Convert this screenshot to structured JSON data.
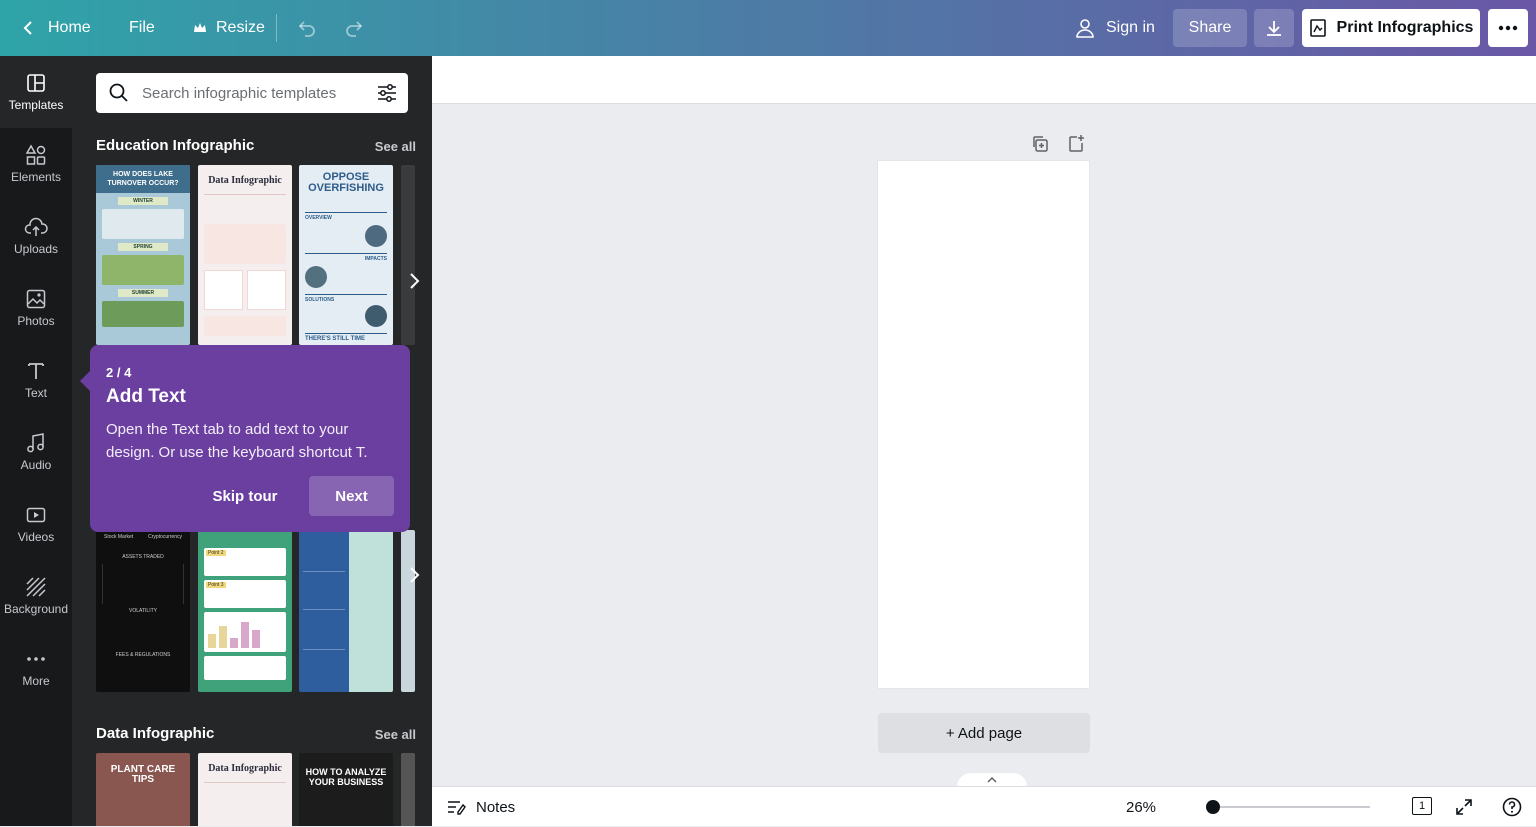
{
  "topbar": {
    "home": "Home",
    "file": "File",
    "resize": "Resize",
    "sign_in": "Sign in",
    "share": "Share",
    "print": "Print Infographics"
  },
  "rail": {
    "items": [
      {
        "label": "Templates",
        "icon": "templates-icon"
      },
      {
        "label": "Elements",
        "icon": "elements-icon"
      },
      {
        "label": "Uploads",
        "icon": "upload-icon"
      },
      {
        "label": "Photos",
        "icon": "photo-icon"
      },
      {
        "label": "Text",
        "icon": "text-icon"
      },
      {
        "label": "Audio",
        "icon": "music-note-icon"
      },
      {
        "label": "Videos",
        "icon": "video-icon"
      },
      {
        "label": "Background",
        "icon": "background-icon"
      },
      {
        "label": "More",
        "icon": "more-dots-icon"
      }
    ]
  },
  "panel": {
    "search_placeholder": "Search infographic templates",
    "sections": [
      {
        "title": "Education Infographic",
        "see_all": "See all"
      },
      {
        "title": "Data Infographic",
        "see_all": "See all"
      }
    ],
    "thumbs": {
      "lake_title": "HOW DOES LAKE TURNOVER OCCUR?",
      "lake_winter": "WINTER",
      "lake_spring": "SPRING",
      "lake_summer": "SUMMER",
      "data_title": "Data Infographic",
      "overfish_title": "OPPOSE OVERFISHING",
      "overfish_overview": "OVERVIEW",
      "overfish_impacts": "IMPACTS",
      "overfish_solutions": "SOLUTIONS",
      "overfish_time": "THERE'S STILL TIME",
      "stock_market": "Stock Market",
      "crypto": "Cryptocurrency",
      "assets": "ASSETS TRADED",
      "volatility": "VOLATILITY",
      "fees": "FEES & REGULATIONS",
      "point2": "Point 2",
      "point3": "Point 3",
      "plant_title": "PLANT CARE TIPS",
      "analyze_title": "HOW TO ANALYZE YOUR BUSINESS"
    }
  },
  "tooltip": {
    "step": "2 / 4",
    "title": "Add Text",
    "body": "Open the Text tab to add text to your design. Or use the keyboard shortcut T.",
    "skip": "Skip tour",
    "next": "Next"
  },
  "canvas": {
    "add_page": "+ Add page"
  },
  "footer": {
    "notes": "Notes",
    "zoom": "26%",
    "zoom_value": 26,
    "page_count": "1"
  },
  "colors": {
    "tooltip": "#6a3fa0",
    "rail": "#18191b",
    "panel": "#252627"
  }
}
